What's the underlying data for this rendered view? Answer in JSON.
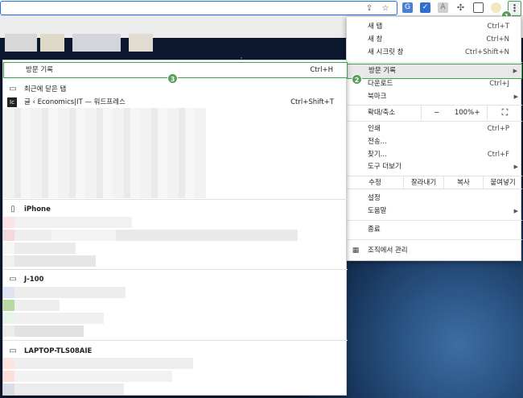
{
  "toolbar": {
    "icons": [
      "share-icon",
      "star-icon",
      "translate-icon",
      "check-extension-icon",
      "pdf-extension-icon",
      "puzzle-icon",
      "sidepanel-icon",
      "profile-icon",
      "kebab-menu-icon"
    ]
  },
  "badges": {
    "b1": "1",
    "b2": "2",
    "b3": "3"
  },
  "menu": {
    "new_tab": "새 탭",
    "new_tab_sc": "Ctrl+T",
    "new_window": "새 창",
    "new_window_sc": "Ctrl+N",
    "incognito": "새 시크릿 창",
    "incognito_sc": "Ctrl+Shift+N",
    "history": "방문 기록",
    "downloads": "다운로드",
    "downloads_sc": "Ctrl+J",
    "bookmarks": "북마크",
    "zoom_label": "확대/축소",
    "zoom_minus": "−",
    "zoom_value": "100%",
    "zoom_plus": "+",
    "fullscreen": "⛶",
    "print": "인쇄",
    "print_sc": "Ctrl+P",
    "cast": "전송...",
    "find": "찾기...",
    "find_sc": "Ctrl+F",
    "more_tools": "도구 더보기",
    "edit_label": "수정",
    "cut": "잘라내기",
    "copy": "복사",
    "paste": "붙여넣기",
    "settings": "설정",
    "help": "도움말",
    "exit": "종료",
    "managed": "조직에서 관리"
  },
  "history_submenu": {
    "title": "방문 기록",
    "title_sc": "Ctrl+H",
    "recently_closed": "최근에 닫은 탭",
    "closed_item": "글 ‹ Economics|IT — 워드프레스",
    "closed_item_sc": "Ctrl+Shift+T",
    "devices": [
      {
        "name": "iPhone",
        "icon": "phone-icon"
      },
      {
        "name": "J-100",
        "icon": "laptop-icon"
      },
      {
        "name": "LAPTOP-TLS08AIE",
        "icon": "laptop-icon"
      }
    ]
  }
}
